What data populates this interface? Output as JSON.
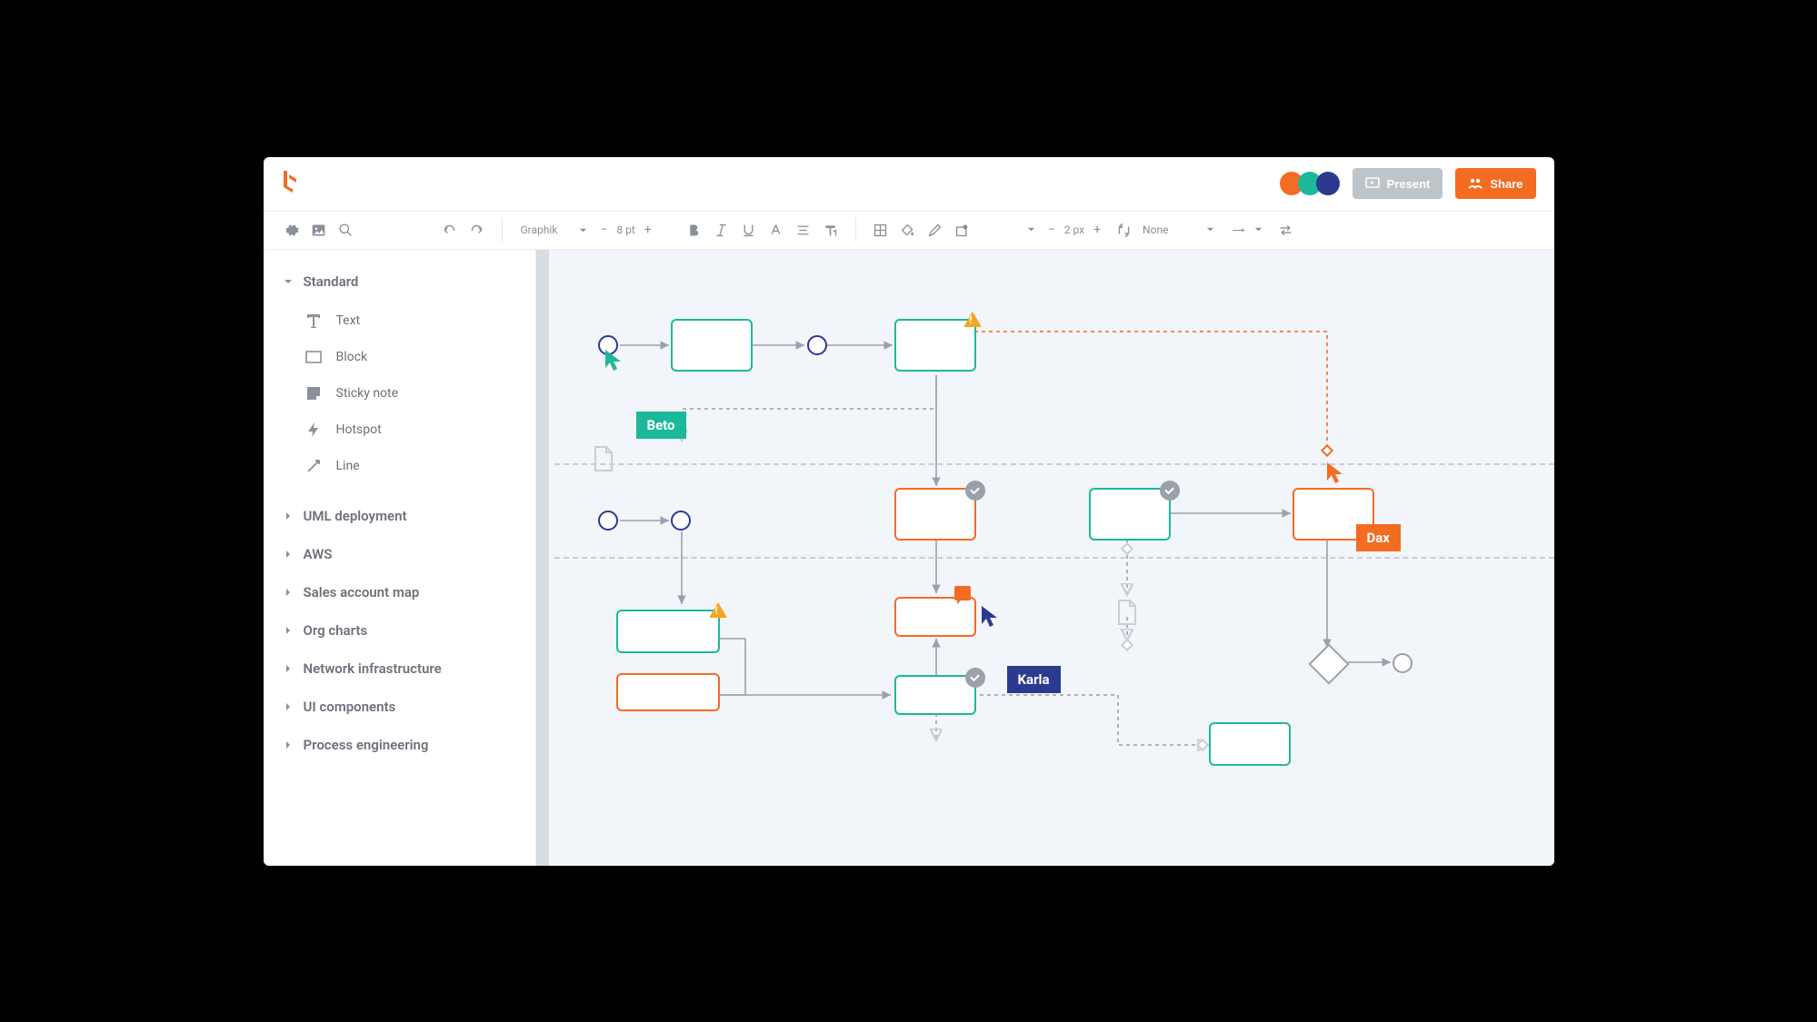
{
  "header": {
    "present_label": "Present",
    "share_label": "Share",
    "presence_colors": [
      "#f36c21",
      "#1bb99a",
      "#2b3a8f"
    ]
  },
  "toolbar": {
    "font_family": "Graphik",
    "font_size": "8 pt",
    "stroke_width": "2 px",
    "line_style": "None"
  },
  "sidebar": {
    "expanded": {
      "label": "Standard",
      "items": [
        {
          "label": "Text"
        },
        {
          "label": "Block"
        },
        {
          "label": "Sticky note"
        },
        {
          "label": "Hotspot"
        },
        {
          "label": "Line"
        }
      ]
    },
    "collapsed": [
      {
        "label": "UML deployment"
      },
      {
        "label": "AWS"
      },
      {
        "label": "Sales account map"
      },
      {
        "label": "Org charts"
      },
      {
        "label": "Network infrastructure"
      },
      {
        "label": "UI components"
      },
      {
        "label": "Process engineering"
      }
    ]
  },
  "collaborators": {
    "beto": "Beto",
    "karla": "Karla",
    "dax": "Dax"
  }
}
